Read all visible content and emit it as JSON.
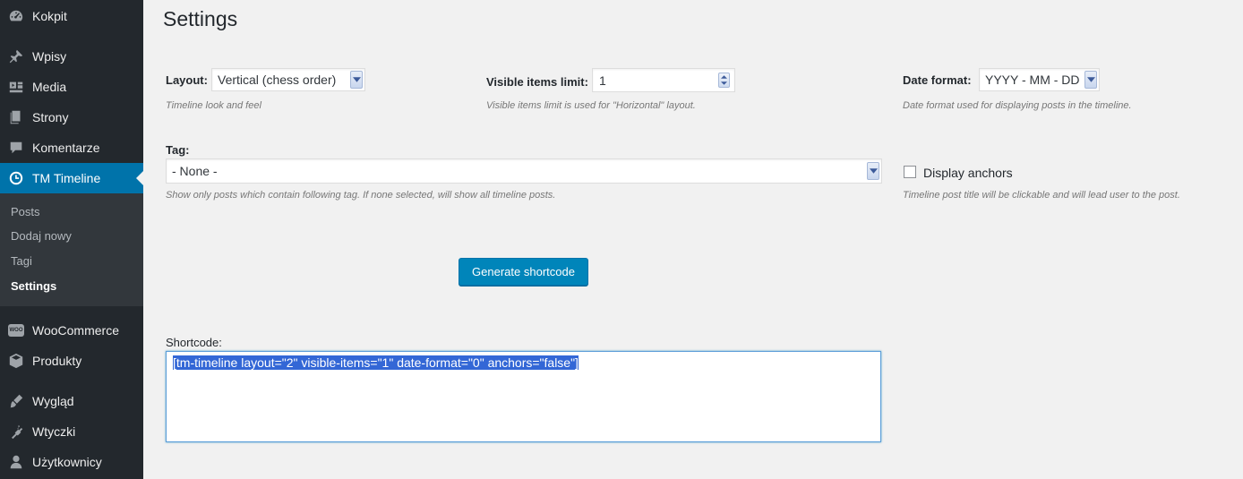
{
  "sidebar": {
    "items": [
      {
        "label": "Kokpit",
        "icon": "dashboard-icon"
      },
      {
        "label": "Wpisy",
        "icon": "pushpin-icon"
      },
      {
        "label": "Media",
        "icon": "media-icon"
      },
      {
        "label": "Strony",
        "icon": "pages-icon"
      },
      {
        "label": "Komentarze",
        "icon": "comments-icon"
      },
      {
        "label": "TM Timeline",
        "icon": "clock-icon"
      },
      {
        "label": "WooCommerce",
        "icon": "woocommerce-icon",
        "icon_text": "WOO"
      },
      {
        "label": "Produkty",
        "icon": "products-icon"
      },
      {
        "label": "Wygląd",
        "icon": "appearance-icon"
      },
      {
        "label": "Wtyczki",
        "icon": "plugins-icon"
      },
      {
        "label": "Użytkownicy",
        "icon": "users-icon"
      }
    ],
    "submenu": [
      {
        "label": "Posts"
      },
      {
        "label": "Dodaj nowy"
      },
      {
        "label": "Tagi"
      },
      {
        "label": "Settings"
      }
    ],
    "accent_color": "#0073aa"
  },
  "page": {
    "title": "Settings",
    "layout": {
      "label": "Layout:",
      "value": "Vertical (chess order)",
      "description": "Timeline look and feel"
    },
    "visible_items": {
      "label": "Visible items limit:",
      "value": "1",
      "description": "Visible items limit is used for \"Horizontal\" layout."
    },
    "date_format": {
      "label": "Date format:",
      "value": "YYYY - MM - DD",
      "description": "Date format used for displaying posts in the timeline."
    },
    "tag": {
      "label": "Tag:",
      "value": "- None -",
      "description": "Show only posts which contain following tag. If none selected, will show all timeline posts."
    },
    "anchors": {
      "label": "Display anchors",
      "checked": false,
      "description": "Timeline post title will be clickable and will lead user to the post."
    },
    "generate_button": "Generate shortcode",
    "shortcode": {
      "label": "Shortcode:",
      "value": "[tm-timeline layout=\"2\" visible-items=\"1\" date-format=\"0\" anchors=\"false\"]"
    }
  }
}
